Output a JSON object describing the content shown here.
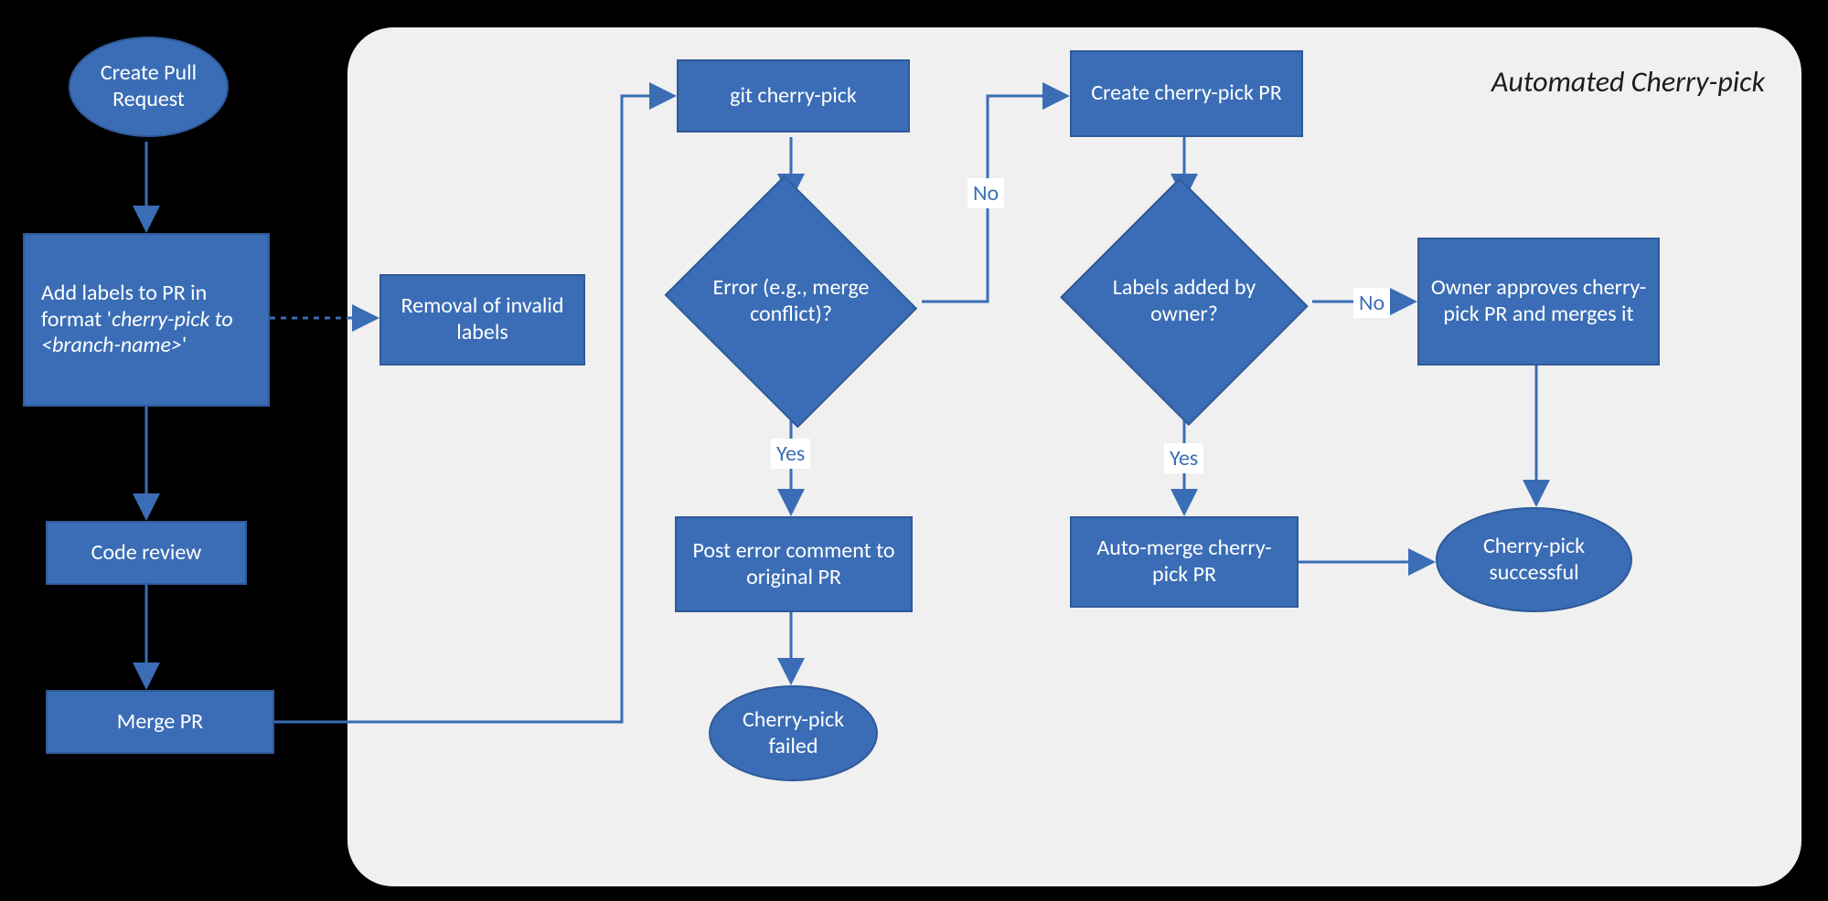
{
  "colors": {
    "node_fill": "#3a6db5",
    "node_stroke": "#2f5a99",
    "region_fill": "#f0f0f0",
    "bg": "#000000",
    "text_on_node": "#ffffff",
    "label_text": "#3a6db5"
  },
  "region": {
    "title": "Automated Cherry-pick"
  },
  "nodes": {
    "create_pr": {
      "type": "ellipse",
      "text": "Create Pull Request"
    },
    "add_labels": {
      "type": "rect",
      "text_html": "Add labels to PR in format '<i>cherry-pick to &lt;branch-name&gt;</i>'"
    },
    "code_review": {
      "type": "rect",
      "text": "Code review"
    },
    "merge_pr": {
      "type": "rect",
      "text": "Merge PR"
    },
    "remove_invalid": {
      "type": "rect",
      "text": "Removal of invalid labels"
    },
    "git_cp": {
      "type": "rect",
      "text": "git cherry-pick"
    },
    "error_q": {
      "type": "diamond",
      "text": "Error (e.g., merge conflict)?"
    },
    "post_error": {
      "type": "rect",
      "text": "Post error comment to original PR"
    },
    "cp_failed": {
      "type": "ellipse",
      "text": "Cherry-pick failed"
    },
    "create_cp_pr": {
      "type": "rect",
      "text": "Create cherry-pick PR"
    },
    "labels_q": {
      "type": "diamond",
      "text": "Labels added by owner?"
    },
    "auto_merge": {
      "type": "rect",
      "text": "Auto-merge cherry-pick PR"
    },
    "owner_approves": {
      "type": "rect",
      "text": "Owner approves cherry-pick PR and merges it"
    },
    "cp_success": {
      "type": "ellipse",
      "text": "Cherry-pick successful"
    }
  },
  "edge_labels": {
    "error_no": "No",
    "error_yes": "Yes",
    "labels_no": "No",
    "labels_yes": "Yes"
  },
  "edges": [
    {
      "from": "create_pr",
      "to": "add_labels",
      "style": "solid"
    },
    {
      "from": "add_labels",
      "to": "remove_invalid",
      "style": "dashed"
    },
    {
      "from": "add_labels",
      "to": "code_review",
      "style": "solid"
    },
    {
      "from": "code_review",
      "to": "merge_pr",
      "style": "solid"
    },
    {
      "from": "merge_pr",
      "to": "git_cp",
      "style": "solid",
      "routing": "elbow"
    },
    {
      "from": "git_cp",
      "to": "error_q",
      "style": "solid"
    },
    {
      "from": "error_q",
      "to": "create_cp_pr",
      "label": "No",
      "style": "solid",
      "routing": "elbow"
    },
    {
      "from": "error_q",
      "to": "post_error",
      "label": "Yes",
      "style": "solid"
    },
    {
      "from": "post_error",
      "to": "cp_failed",
      "style": "solid"
    },
    {
      "from": "create_cp_pr",
      "to": "labels_q",
      "style": "solid"
    },
    {
      "from": "labels_q",
      "to": "owner_approves",
      "label": "No",
      "style": "solid"
    },
    {
      "from": "labels_q",
      "to": "auto_merge",
      "label": "Yes",
      "style": "solid"
    },
    {
      "from": "auto_merge",
      "to": "cp_success",
      "style": "solid"
    },
    {
      "from": "owner_approves",
      "to": "cp_success",
      "style": "solid"
    }
  ]
}
